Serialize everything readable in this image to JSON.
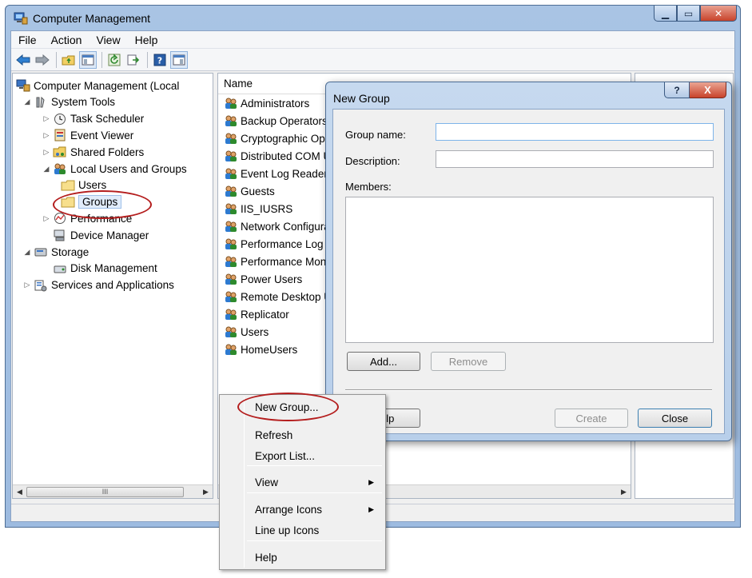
{
  "window": {
    "title": "Computer Management"
  },
  "menubar": [
    "File",
    "Action",
    "View",
    "Help"
  ],
  "tree": [
    {
      "label": "Computer Management (Local",
      "level": 0,
      "arrow": "",
      "icon": "computer-management-icon"
    },
    {
      "label": "System Tools",
      "level": 1,
      "arrow": "◢",
      "icon": "tools-icon"
    },
    {
      "label": "Task Scheduler",
      "level": 2,
      "arrow": "▷",
      "icon": "clock-icon"
    },
    {
      "label": "Event Viewer",
      "level": 2,
      "arrow": "▷",
      "icon": "event-viewer-icon"
    },
    {
      "label": "Shared Folders",
      "level": 2,
      "arrow": "▷",
      "icon": "shared-folder-icon"
    },
    {
      "label": "Local Users and Groups",
      "level": 2,
      "arrow": "◢",
      "icon": "users-icon"
    },
    {
      "label": "Users",
      "level": 3,
      "arrow": "",
      "icon": "folder-icon"
    },
    {
      "label": "Groups",
      "level": 3,
      "arrow": "",
      "icon": "folder-icon"
    },
    {
      "label": "Performance",
      "level": 2,
      "arrow": "▷",
      "icon": "performance-icon"
    },
    {
      "label": "Device Manager",
      "level": 2,
      "arrow": "",
      "icon": "device-manager-icon"
    },
    {
      "label": "Storage",
      "level": 1,
      "arrow": "◢",
      "icon": "storage-icon"
    },
    {
      "label": "Disk Management",
      "level": 2,
      "arrow": "",
      "icon": "disk-icon"
    },
    {
      "label": "Services and Applications",
      "level": 1,
      "arrow": "▷",
      "icon": "services-icon"
    }
  ],
  "list": {
    "header": "Name",
    "items": [
      "Administrators",
      "Backup Operators",
      "Cryptographic Operators",
      "Distributed COM Users",
      "Event Log Readers",
      "Guests",
      "IIS_IUSRS",
      "Network Configuration Operators",
      "Performance Log Users",
      "Performance Monitor Users",
      "Power Users",
      "Remote Desktop Users",
      "Replicator",
      "Users",
      "HomeUsers"
    ]
  },
  "scroll": {
    "grip": "III"
  },
  "dialog": {
    "title": "New Group",
    "help_glyph": "?",
    "close_glyph": "X",
    "group_name_label": "Group name:",
    "group_name_value": "",
    "description_label": "Description:",
    "description_value": "",
    "members_label": "Members:",
    "add_label": "Add...",
    "remove_label": "Remove",
    "help_label": "Help",
    "create_label": "Create",
    "close_label": "Close"
  },
  "context_menu": [
    {
      "label": "New Group...",
      "submenu": false
    },
    {
      "label": "Refresh",
      "submenu": false
    },
    {
      "label": "Export List...",
      "submenu": false
    },
    {
      "label": "View",
      "submenu": true
    },
    {
      "label": "Arrange Icons",
      "submenu": true
    },
    {
      "label": "Line up Icons",
      "submenu": false
    },
    {
      "label": "Help",
      "submenu": false
    }
  ],
  "colors": {
    "annotation": "#b41d1d",
    "titlebar": "#a9c4e4",
    "selection": "#e1ecfa"
  }
}
